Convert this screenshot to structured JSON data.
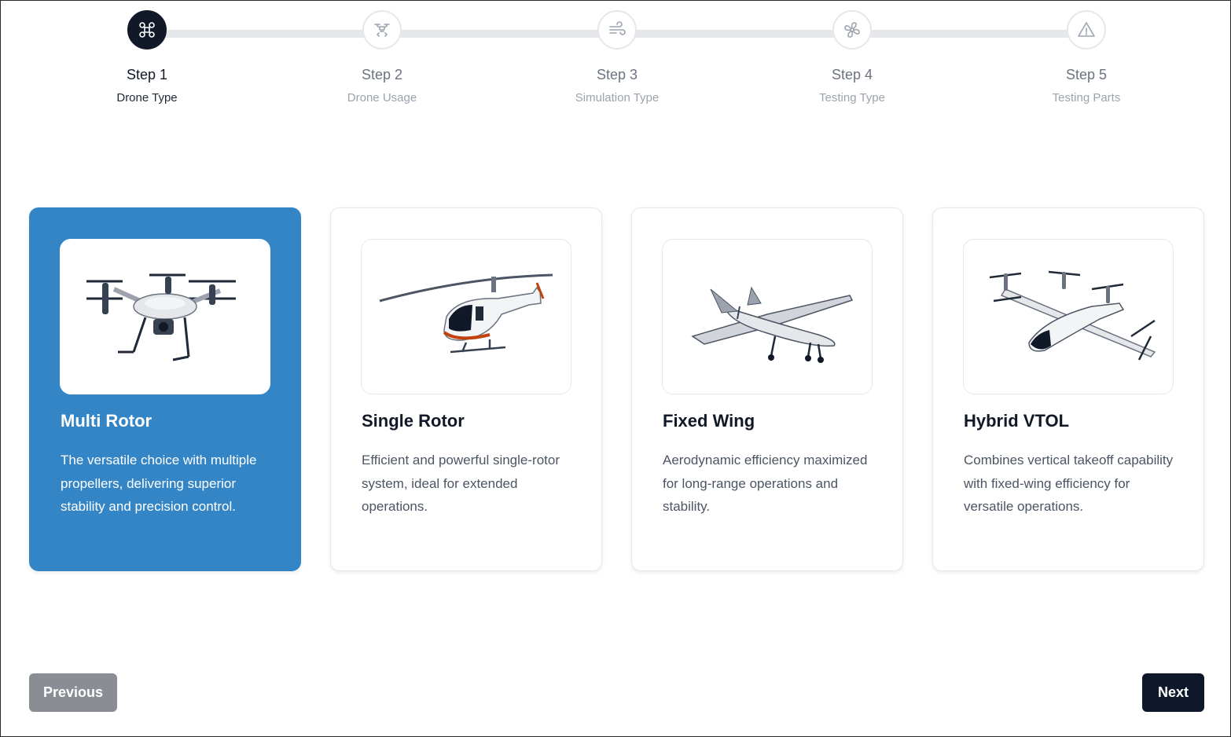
{
  "stepper": {
    "steps": [
      {
        "label": "Step 1",
        "sub": "Drone Type",
        "icon": "drone-icon",
        "active": true
      },
      {
        "label": "Step 2",
        "sub": "Drone Usage",
        "icon": "drone-usage-icon",
        "active": false
      },
      {
        "label": "Step 3",
        "sub": "Simulation Type",
        "icon": "wind-icon",
        "active": false
      },
      {
        "label": "Step 4",
        "sub": "Testing Type",
        "icon": "fan-icon",
        "active": false
      },
      {
        "label": "Step 5",
        "sub": "Testing Parts",
        "icon": "warning-triangle-icon",
        "active": false
      }
    ]
  },
  "cards": [
    {
      "title": "Multi Rotor",
      "desc": "The versatile choice with multiple propellers, delivering superior stability and precision control.",
      "selected": true,
      "image": "multi-rotor-drone"
    },
    {
      "title": "Single Rotor",
      "desc": "Efficient and powerful single-rotor system, ideal for extended operations.",
      "selected": false,
      "image": "helicopter"
    },
    {
      "title": "Fixed Wing",
      "desc": "Aerodynamic efficiency maximized for long-range operations and stability.",
      "selected": false,
      "image": "fixed-wing-drone"
    },
    {
      "title": "Hybrid VTOL",
      "desc": "Combines vertical takeoff capability with fixed-wing efficiency for versatile operations.",
      "selected": false,
      "image": "vtol-aircraft"
    }
  ],
  "nav": {
    "previous_label": "Previous",
    "next_label": "Next"
  },
  "colors": {
    "accent": "#3385c6",
    "dark": "#0f172a",
    "muted_button": "#8a8d93"
  }
}
